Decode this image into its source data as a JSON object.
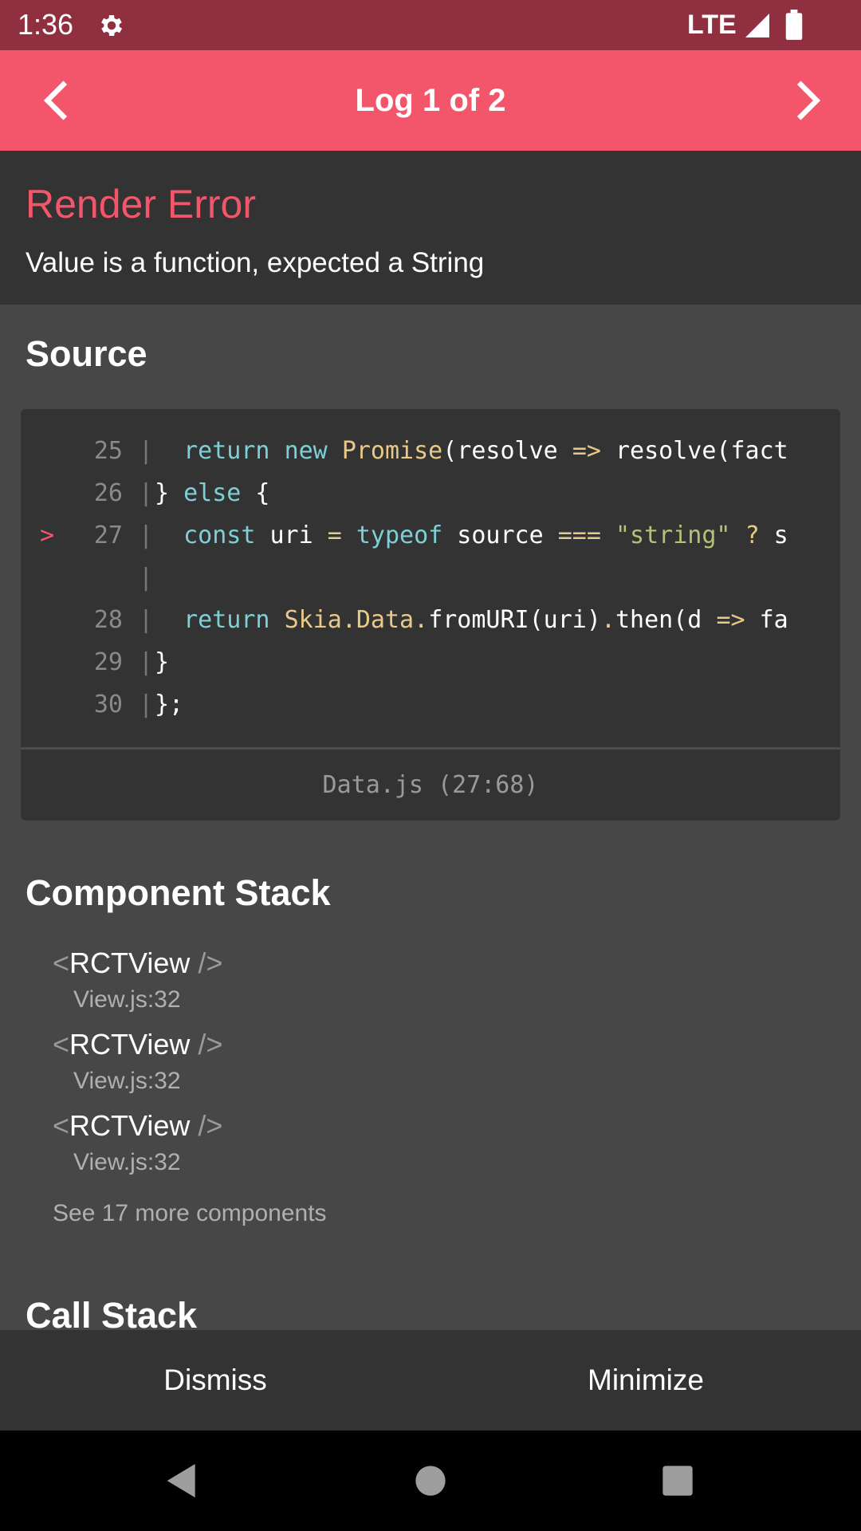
{
  "status_bar": {
    "time": "1:36",
    "network": "LTE",
    "icons": [
      "gear-icon",
      "signal-icon",
      "battery-icon"
    ]
  },
  "header": {
    "title": "Log 1 of 2",
    "prev_icon": "chevron-left-icon",
    "next_icon": "chevron-right-icon"
  },
  "error": {
    "title": "Render Error",
    "message": "Value is a function, expected a String"
  },
  "source": {
    "heading": "Source",
    "lines": [
      {
        "marker": "",
        "num": "25",
        "sep": "|",
        "tokens": [
          {
            "t": "  ",
            "c": "plain"
          },
          {
            "t": "return",
            "c": "kw"
          },
          {
            "t": " ",
            "c": "plain"
          },
          {
            "t": "new",
            "c": "kw"
          },
          {
            "t": " ",
            "c": "plain"
          },
          {
            "t": "Promise",
            "c": "cls"
          },
          {
            "t": "(resolve ",
            "c": "plain"
          },
          {
            "t": "=>",
            "c": "op"
          },
          {
            "t": " resolve(fact",
            "c": "plain"
          }
        ]
      },
      {
        "marker": "",
        "num": "26",
        "sep": "|",
        "tokens": [
          {
            "t": "} ",
            "c": "plain"
          },
          {
            "t": "else",
            "c": "kw"
          },
          {
            "t": " {",
            "c": "plain"
          }
        ]
      },
      {
        "marker": ">",
        "num": "27",
        "sep": "|",
        "tokens": [
          {
            "t": "  ",
            "c": "plain"
          },
          {
            "t": "const",
            "c": "kw"
          },
          {
            "t": " uri ",
            "c": "plain"
          },
          {
            "t": "=",
            "c": "op"
          },
          {
            "t": " ",
            "c": "plain"
          },
          {
            "t": "typeof",
            "c": "kw"
          },
          {
            "t": " source ",
            "c": "plain"
          },
          {
            "t": "===",
            "c": "op"
          },
          {
            "t": " ",
            "c": "plain"
          },
          {
            "t": "\"string\"",
            "c": "str"
          },
          {
            "t": " ",
            "c": "plain"
          },
          {
            "t": "?",
            "c": "op"
          },
          {
            "t": " s",
            "c": "plain"
          }
        ]
      },
      {
        "marker": "",
        "num": "",
        "sep": "|",
        "tokens": []
      },
      {
        "marker": "",
        "num": "28",
        "sep": "|",
        "tokens": [
          {
            "t": "  ",
            "c": "plain"
          },
          {
            "t": "return",
            "c": "kw"
          },
          {
            "t": " ",
            "c": "plain"
          },
          {
            "t": "Skia",
            "c": "cls"
          },
          {
            "t": ".",
            "c": "op"
          },
          {
            "t": "Data",
            "c": "cls"
          },
          {
            "t": ".",
            "c": "op"
          },
          {
            "t": "fromURI(uri)",
            "c": "plain"
          },
          {
            "t": ".",
            "c": "op"
          },
          {
            "t": "then(d ",
            "c": "plain"
          },
          {
            "t": "=>",
            "c": "op"
          },
          {
            "t": " fa",
            "c": "plain"
          }
        ]
      },
      {
        "marker": "",
        "num": "29",
        "sep": "|",
        "tokens": [
          {
            "t": "}",
            "c": "plain"
          }
        ]
      },
      {
        "marker": "",
        "num": "30",
        "sep": "|",
        "tokens": [
          {
            "t": "};",
            "c": "plain"
          }
        ]
      }
    ],
    "file": "Data.js (27:68)"
  },
  "component_stack": {
    "heading": "Component Stack",
    "items": [
      {
        "open": "<",
        "name": "RCTView",
        "close": " />",
        "location": "View.js:32"
      },
      {
        "open": "<",
        "name": "RCTView",
        "close": " />",
        "location": "View.js:32"
      },
      {
        "open": "<",
        "name": "RCTView",
        "close": " />",
        "location": "View.js:32"
      }
    ],
    "see_more": "See 17 more components"
  },
  "call_stack": {
    "heading": "Call Stack"
  },
  "footer": {
    "dismiss_label": "Dismiss",
    "minimize_label": "Minimize"
  },
  "navigation_bar": {
    "icons": [
      "back-icon",
      "home-icon",
      "recents-icon"
    ]
  }
}
